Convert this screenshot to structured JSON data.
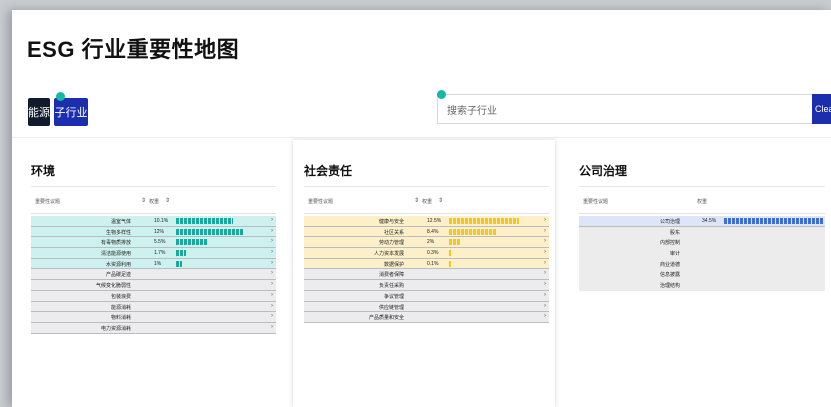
{
  "title": "ESG 行业重要性地图",
  "buttons": {
    "energy": "能源",
    "sub_industry": "子行业",
    "clear": "Clear"
  },
  "search": {
    "placeholder": "搜索子行业"
  },
  "table_headers": {
    "topic": "重要性议题",
    "weight": "权重",
    "sort": "⇕"
  },
  "panels": {
    "environment": {
      "title": "环境",
      "rows": [
        {
          "name": "温室气体",
          "pct": "10.1%",
          "level": 0.101,
          "hl": true
        },
        {
          "name": "生物多样性",
          "pct": "12%",
          "level": 0.12,
          "hl": true
        },
        {
          "name": "有毒物质排放",
          "pct": "5.5%",
          "level": 0.055,
          "hl": true
        },
        {
          "name": "清洁能源使用",
          "pct": "1.7%",
          "level": 0.017,
          "hl": true
        },
        {
          "name": "水资源利用",
          "pct": "1%",
          "level": 0.01,
          "hl": true
        },
        {
          "name": "产品碳足迹",
          "pct": "",
          "level": 0,
          "hl": false
        },
        {
          "name": "气候变化脆弱性",
          "pct": "",
          "level": 0,
          "hl": false
        },
        {
          "name": "包装浪费",
          "pct": "",
          "level": 0,
          "hl": false
        },
        {
          "name": "能源消耗",
          "pct": "",
          "level": 0,
          "hl": false
        },
        {
          "name": "物料消耗",
          "pct": "",
          "level": 0,
          "hl": false
        },
        {
          "name": "电力资源消耗",
          "pct": "",
          "level": 0,
          "hl": false
        }
      ]
    },
    "social": {
      "title": "社会责任",
      "rows": [
        {
          "name": "健康与安全",
          "pct": "12.5%",
          "level": 0.125,
          "hl": true
        },
        {
          "name": "社区关系",
          "pct": "8.4%",
          "level": 0.084,
          "hl": true
        },
        {
          "name": "劳动力管理",
          "pct": "2%",
          "level": 0.02,
          "hl": true
        },
        {
          "name": "人力资本发展",
          "pct": "0.3%",
          "level": 0.003,
          "hl": true
        },
        {
          "name": "数据保护",
          "pct": "0.1%",
          "level": 0.001,
          "hl": true
        },
        {
          "name": "消费者保障",
          "pct": "",
          "level": 0,
          "hl": false
        },
        {
          "name": "负责任采购",
          "pct": "",
          "level": 0,
          "hl": false
        },
        {
          "name": "争议管理",
          "pct": "",
          "level": 0,
          "hl": false
        },
        {
          "name": "供应链管理",
          "pct": "",
          "level": 0,
          "hl": false
        },
        {
          "name": "产品质量和安全",
          "pct": "",
          "level": 0,
          "hl": false
        }
      ]
    },
    "governance": {
      "title": "公司治理",
      "rows": [
        {
          "name": "公司治理",
          "pct": "34.5%",
          "level": 0.345,
          "hl": true
        },
        {
          "name": "股东",
          "pct": "",
          "level": 0,
          "hl": false
        },
        {
          "name": "内部控制",
          "pct": "",
          "level": 0,
          "hl": false
        },
        {
          "name": "审计",
          "pct": "",
          "level": 0,
          "hl": false
        },
        {
          "name": "商业道德",
          "pct": "",
          "level": 0,
          "hl": false
        },
        {
          "name": "信息披露",
          "pct": "",
          "level": 0,
          "hl": false
        },
        {
          "name": "治理结构",
          "pct": "",
          "level": 0,
          "hl": false
        }
      ]
    }
  },
  "colors": {
    "primary": "#1b2fae",
    "dark": "#0f1c2e",
    "teal": "#1aa99e",
    "gold": "#f3c623",
    "blue": "#3d6fd6"
  }
}
